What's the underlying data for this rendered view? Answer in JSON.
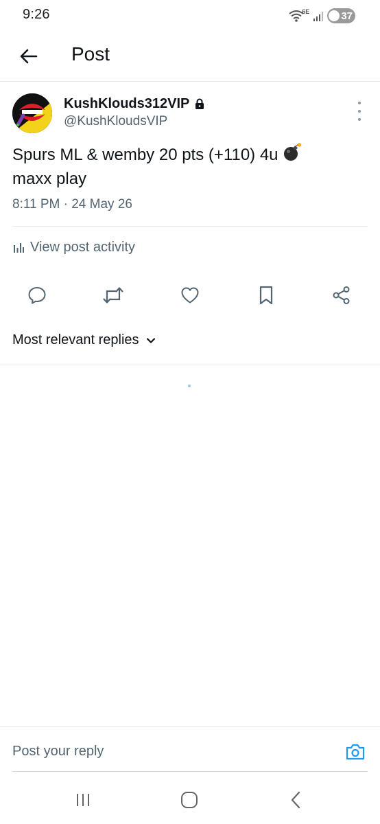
{
  "status_bar": {
    "time": "9:26",
    "network": "6E",
    "battery": "37"
  },
  "header": {
    "title": "Post"
  },
  "post": {
    "display_name": "KushKlouds312VIP",
    "handle": "@KushKloudsVIP",
    "text_line1": "Spurs ML & wemby 20 pts (+110) 4u",
    "text_line2": "maxx play",
    "timestamp": "8:11 PM · 24 May 26",
    "view_activity": "View post activity"
  },
  "replies": {
    "sort_label": "Most relevant replies"
  },
  "reply_bar": {
    "placeholder": "Post your reply"
  },
  "colors": {
    "text_primary": "#0f1419",
    "text_secondary": "#536471",
    "accent": "#1d9bf0",
    "divider": "#e6e9eb"
  },
  "icons": {
    "lock": "lock-icon",
    "reply": "reply-icon",
    "repost": "repost-icon",
    "like": "heart-icon",
    "bookmark": "bookmark-icon",
    "share": "share-icon",
    "camera": "camera-icon"
  }
}
